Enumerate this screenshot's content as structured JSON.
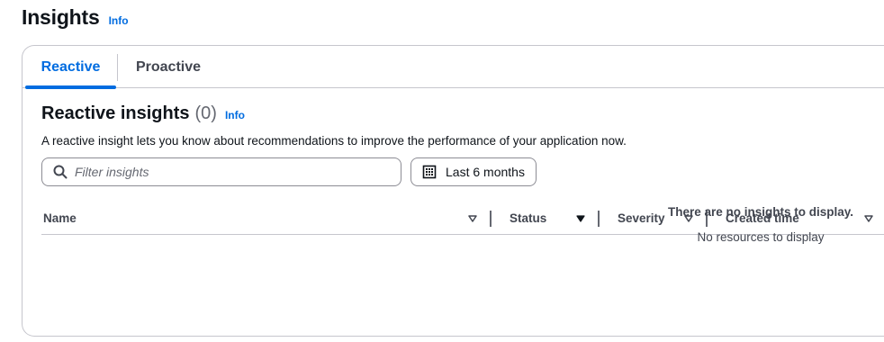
{
  "page": {
    "title": "Insights",
    "info_label": "Info"
  },
  "tabs": [
    {
      "label": "Reactive",
      "active": true
    },
    {
      "label": "Proactive",
      "active": false
    }
  ],
  "section": {
    "title": "Reactive insights",
    "count": "(0)",
    "info_label": "Info",
    "description": "A reactive insight lets you know about recommendations to improve the performance of your application now."
  },
  "filter": {
    "placeholder": "Filter insights",
    "value": "",
    "icon": "search-icon"
  },
  "date_range": {
    "label": "Last 6 months",
    "icon": "calendar-icon"
  },
  "table": {
    "columns": [
      {
        "label": "Name",
        "sort": "sortable"
      },
      {
        "label": "Status",
        "sort": "sorted-descending"
      },
      {
        "label": "Severity",
        "sort": "sortable"
      },
      {
        "label": "Created time",
        "sort": "sortable"
      }
    ],
    "rows": [],
    "empty_title": "There are no insights to display.",
    "empty_subtitle": "No resources to display"
  },
  "colors": {
    "accent": "#006ce0",
    "text": "#0f141a",
    "muted": "#424650",
    "border": "#c6c6cd"
  }
}
